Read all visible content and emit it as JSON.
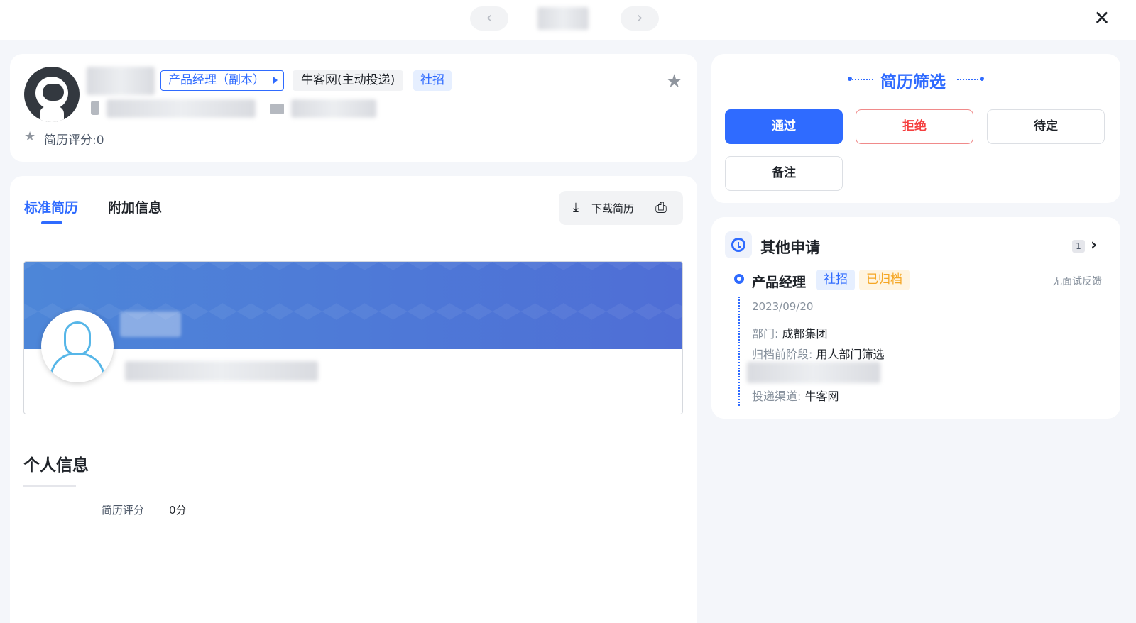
{
  "topbar": {
    "prev_icon": "‹",
    "next_icon": "›",
    "close_icon": "✕"
  },
  "profile": {
    "job_tag": "产品经理（副本）",
    "source_tag": "牛客网(主动投递)",
    "type_tag": "社招",
    "score_label": "简历评分:0",
    "star_icon": "★"
  },
  "tabs": {
    "standard": "标准简历",
    "extra": "附加信息"
  },
  "toolbar": {
    "download_icon": "⤓",
    "download_label": "下载简历",
    "print_icon": "⎙"
  },
  "personal": {
    "section_title": "个人信息",
    "score_label": "简历评分",
    "score_value": "0分"
  },
  "screening": {
    "title": "简历筛选",
    "pass": "通过",
    "reject": "拒绝",
    "pending": "待定",
    "note": "备注"
  },
  "other_applications": {
    "title": "其他申请",
    "count": "1",
    "chevron": "›",
    "item": {
      "job": "产品经理",
      "type": "社招",
      "status": "已归档",
      "feedback": "无面试反馈",
      "date": "2023/09/20",
      "dept_label": "部门:",
      "dept_value": "成都集团",
      "stage_label": "归档前阶段:",
      "stage_value": "用人部门筛选",
      "channel_label": "投递渠道:",
      "channel_value": "牛客网"
    }
  },
  "colors": {
    "accent": "#2f6bff",
    "reject": "#f53f3f",
    "archived": "#f5a623",
    "background": "#f4f6fa"
  }
}
